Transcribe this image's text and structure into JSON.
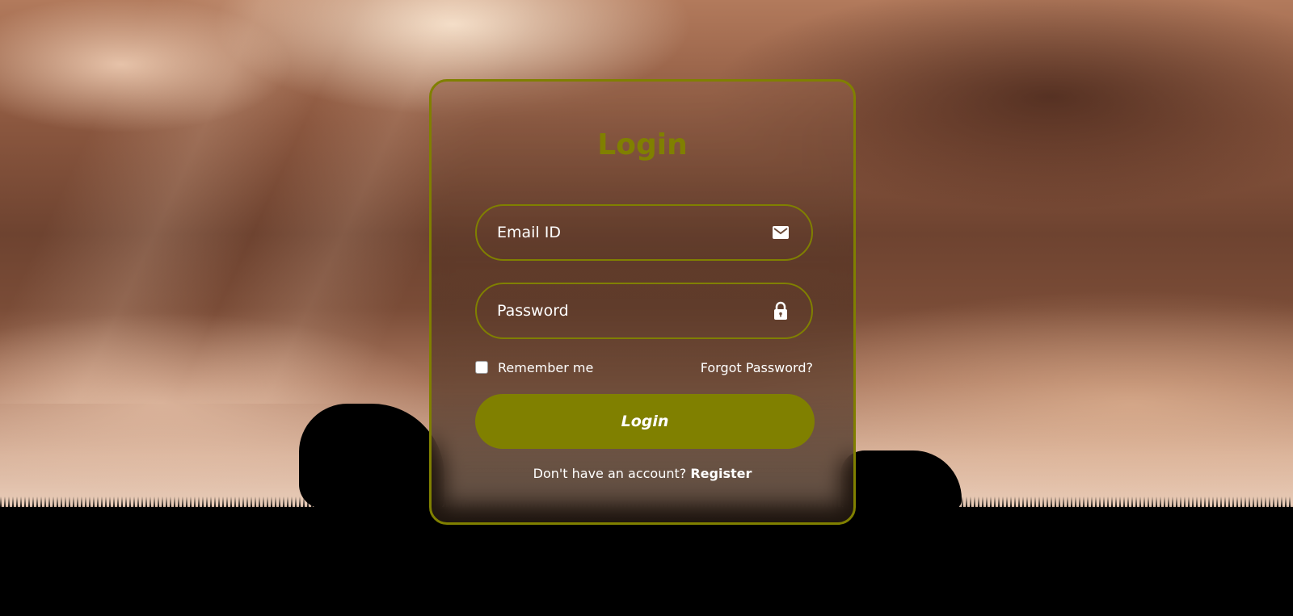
{
  "login_card": {
    "title": "Login",
    "email": {
      "placeholder": "Email ID",
      "icon": "mail-icon"
    },
    "password": {
      "placeholder": "Password",
      "icon": "lock-icon"
    },
    "remember_label": "Remember me",
    "forgot_label": "Forgot Password?",
    "submit_label": "Login",
    "register_prompt": "Don't have an account?",
    "register_label": "Register"
  },
  "colors": {
    "accent": "#808000",
    "text": "#ffffff"
  }
}
